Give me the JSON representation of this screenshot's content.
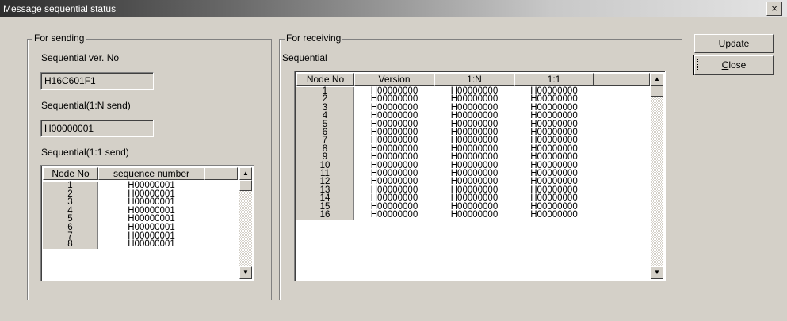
{
  "window": {
    "title": "Message sequential status",
    "close_glyph": "×"
  },
  "sending": {
    "group_label": "For sending",
    "ver_label": "Sequential ver. No",
    "ver_value": "H16C601F1",
    "n_label": "Sequential(1:N send)",
    "n_value": "H00000001",
    "one_label": "Sequential(1:1 send)",
    "table": {
      "headers": [
        "Node No",
        "sequence number"
      ],
      "rows": [
        [
          "1",
          "H00000001"
        ],
        [
          "2",
          "H00000001"
        ],
        [
          "3",
          "H00000001"
        ],
        [
          "4",
          "H00000001"
        ],
        [
          "5",
          "H00000001"
        ],
        [
          "6",
          "H00000001"
        ],
        [
          "7",
          "H00000001"
        ],
        [
          "8",
          "H00000001"
        ]
      ]
    }
  },
  "receiving": {
    "group_label": "For receiving",
    "seq_label": "Sequential",
    "table": {
      "headers": [
        "Node No",
        "Version",
        "1:N",
        "1:1"
      ],
      "rows": [
        [
          "1",
          "H00000000",
          "H00000000",
          "H00000000"
        ],
        [
          "2",
          "H00000000",
          "H00000000",
          "H00000000"
        ],
        [
          "3",
          "H00000000",
          "H00000000",
          "H00000000"
        ],
        [
          "4",
          "H00000000",
          "H00000000",
          "H00000000"
        ],
        [
          "5",
          "H00000000",
          "H00000000",
          "H00000000"
        ],
        [
          "6",
          "H00000000",
          "H00000000",
          "H00000000"
        ],
        [
          "7",
          "H00000000",
          "H00000000",
          "H00000000"
        ],
        [
          "8",
          "H00000000",
          "H00000000",
          "H00000000"
        ],
        [
          "9",
          "H00000000",
          "H00000000",
          "H00000000"
        ],
        [
          "10",
          "H00000000",
          "H00000000",
          "H00000000"
        ],
        [
          "11",
          "H00000000",
          "H00000000",
          "H00000000"
        ],
        [
          "12",
          "H00000000",
          "H00000000",
          "H00000000"
        ],
        [
          "13",
          "H00000000",
          "H00000000",
          "H00000000"
        ],
        [
          "14",
          "H00000000",
          "H00000000",
          "H00000000"
        ],
        [
          "15",
          "H00000000",
          "H00000000",
          "H00000000"
        ],
        [
          "16",
          "H00000000",
          "H00000000",
          "H00000000"
        ]
      ]
    }
  },
  "buttons": {
    "update": {
      "pre": "",
      "key": "U",
      "rest": "pdate"
    },
    "close": {
      "pre": "",
      "key": "C",
      "rest": "lose"
    }
  },
  "icons": {
    "scroll_up": "▲",
    "scroll_down": "▼"
  }
}
